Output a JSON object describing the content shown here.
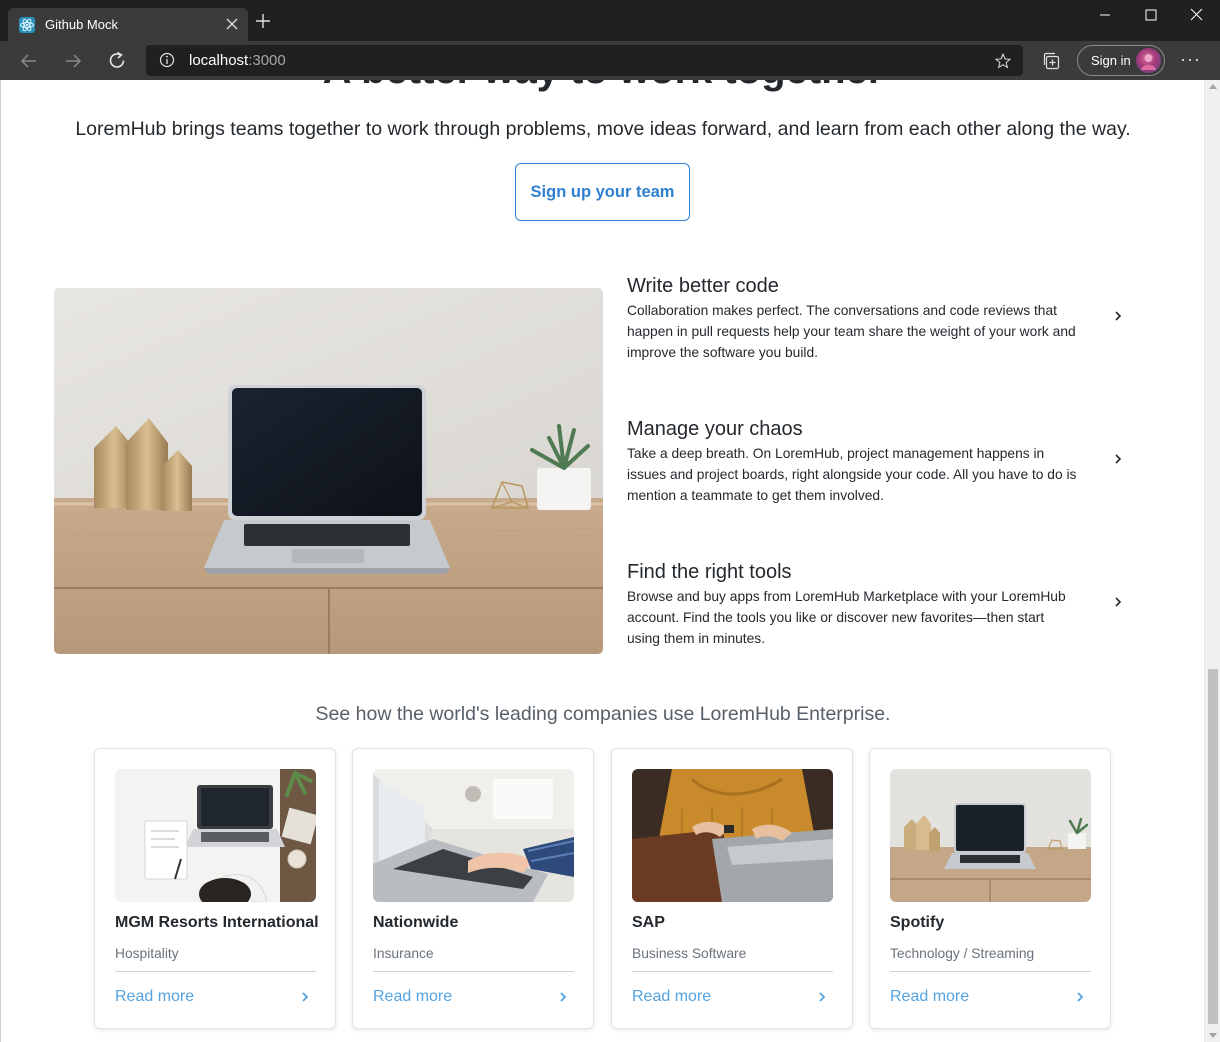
{
  "browser": {
    "tab_title": "Github Mock",
    "url_host": "localhost",
    "url_port": ":3000",
    "sign_in_label": "Sign in",
    "more_label": "···"
  },
  "page": {
    "cut_heading": "A better way to work together",
    "intro": "LoremHub brings teams together to work through problems, move ideas forward, and learn from each other along the way.",
    "cta_label": "Sign up your team",
    "features": [
      {
        "title": "Write better code",
        "description": "Collaboration makes perfect. The conversations and code reviews that happen in pull requests help your team share the weight of your work and improve the software you build."
      },
      {
        "title": "Manage your chaos",
        "description": "Take a deep breath. On LoremHub, project management happens in issues and project boards, right alongside your code. All you have to do is mention a teammate to get them involved."
      },
      {
        "title": "Find the right tools",
        "description": "Browse and buy apps from LoremHub Marketplace with your LoremHub account. Find the tools you like or discover new favorites—then start using them in minutes."
      }
    ],
    "companies_title": "See how the world's leading companies use LoremHub Enterprise.",
    "companies": [
      {
        "name": "MGM Resorts International",
        "industry": "Hospitality",
        "link": "Read more"
      },
      {
        "name": "Nationwide",
        "industry": "Insurance",
        "link": "Read more"
      },
      {
        "name": "SAP",
        "industry": "Business Software",
        "link": "Read more"
      },
      {
        "name": "Spotify",
        "industry": "Technology / Streaming",
        "link": "Read more"
      }
    ]
  },
  "colors": {
    "accent_blue": "#2f80d1",
    "link_blue": "#55a3e0",
    "text_dark": "#24292e",
    "text_muted": "#6a737d",
    "chrome_dark": "#202020",
    "chrome_mid": "#3b3b3b"
  },
  "icons": {
    "favicon": "react-atom-icon",
    "tab_close": "close-icon",
    "new_tab": "plus-icon",
    "back": "arrow-left-icon",
    "forward": "arrow-right-icon",
    "refresh": "refresh-icon",
    "site_info": "info-icon",
    "favorite": "star-icon",
    "collections": "collections-icon",
    "menu": "more-icon",
    "feature_chevron": "chevron-right-icon",
    "card_chevron": "chevron-right-icon"
  }
}
